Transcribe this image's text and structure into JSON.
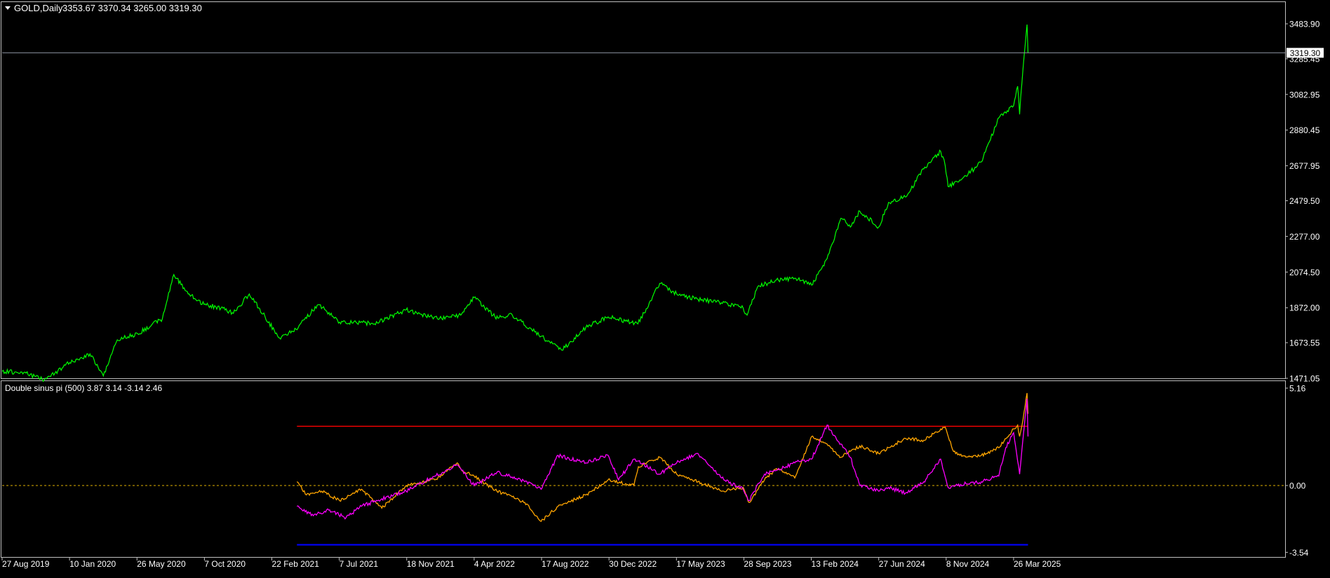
{
  "colors": {
    "background": "#000000",
    "frame": "#c0c0c0",
    "text": "#ffffff",
    "price": "#00ff00",
    "bid_line": "#8a93a0",
    "series1": "#ffa500",
    "series2": "#ff00ff",
    "upper_level": "#ff0000",
    "lower_level": "#0000ff",
    "zero_level": "#e0b000"
  },
  "main_panel": {
    "title": "GOLD,Daily",
    "ohlc": "3353.67 3370.34 3265.00 3319.30",
    "current_price_label": "3319.30"
  },
  "indicator_panel": {
    "title": "Double sinus pi (500) 3.87 3.14 -3.14 2.46"
  },
  "chart_data": [
    {
      "type": "line",
      "title": "GOLD,Daily",
      "ylim": [
        1400,
        3550
      ],
      "y_ticks": [
        "3483.90",
        "3285.45",
        "3082.95",
        "2880.45",
        "2677.95",
        "2479.50",
        "2277.00",
        "2074.50",
        "1872.00",
        "1673.55",
        "1471.05"
      ],
      "x_ticks": [
        "27 Aug 2019",
        "10 Jan 2020",
        "26 May 2020",
        "7 Oct 2020",
        "22 Feb 2021",
        "7 Jul 2021",
        "18 Nov 2021",
        "4 Apr 2022",
        "17 Aug 2022",
        "30 Dec 2022",
        "17 May 2023",
        "28 Sep 2023",
        "13 Feb 2024",
        "27 Jun 2024",
        "8 Nov 2024",
        "26 Mar 2025"
      ],
      "current_value": 3319.3,
      "series": [
        {
          "x": [
            "2019-08-27",
            "2019-10-10",
            "2019-11-20",
            "2020-01-10",
            "2020-02-20",
            "2020-03-18",
            "2020-04-15",
            "2020-05-26",
            "2020-07-15",
            "2020-08-07",
            "2020-09-05",
            "2020-10-07",
            "2020-11-10",
            "2020-12-05",
            "2021-01-06",
            "2021-03-08",
            "2021-04-10",
            "2021-05-25",
            "2021-07-07",
            "2021-08-09",
            "2021-09-15",
            "2021-11-18",
            "2022-01-20",
            "2022-03-08",
            "2022-04-04",
            "2022-05-16",
            "2022-06-20",
            "2022-08-17",
            "2022-09-28",
            "2022-11-15",
            "2022-12-30",
            "2023-02-28",
            "2023-04-13",
            "2023-05-17",
            "2023-06-29",
            "2023-08-15",
            "2023-09-28",
            "2023-10-06",
            "2023-10-27",
            "2023-12-04",
            "2024-01-10",
            "2024-02-13",
            "2024-03-15",
            "2024-04-12",
            "2024-05-01",
            "2024-05-20",
            "2024-06-27",
            "2024-07-17",
            "2024-08-20",
            "2024-09-26",
            "2024-10-30",
            "2024-11-08",
            "2024-11-14",
            "2024-12-20",
            "2025-01-20",
            "2025-02-24",
            "2025-03-26",
            "2025-04-03",
            "2025-04-07",
            "2025-04-14",
            "2025-04-22",
            "2025-04-24"
          ],
          "y": [
            1510,
            1505,
            1462,
            1560,
            1610,
            1485,
            1690,
            1725,
            1810,
            2060,
            1950,
            1890,
            1870,
            1840,
            1950,
            1700,
            1750,
            1890,
            1790,
            1790,
            1780,
            1860,
            1810,
            1830,
            1930,
            1820,
            1830,
            1710,
            1630,
            1760,
            1820,
            1780,
            2010,
            1950,
            1920,
            1900,
            1870,
            1830,
            1990,
            2030,
            2040,
            2000,
            2150,
            2380,
            2330,
            2420,
            2330,
            2470,
            2500,
            2660,
            2760,
            2680,
            2560,
            2620,
            2700,
            2950,
            3020,
            3130,
            2970,
            3230,
            3480,
            3319.3
          ]
        }
      ]
    },
    {
      "type": "line",
      "title": "Double sinus pi (500) 3.87 3.14 -3.14 2.46",
      "ylim": [
        -3.54,
        5.16
      ],
      "y_ticks": [
        "5.16",
        "0.00",
        "-3.54"
      ],
      "levels": [
        3.14,
        0.0,
        -3.14
      ],
      "series": [
        {
          "color": "#ffa500",
          "x": [
            "2021-04-12",
            "2021-05-01",
            "2021-06-01",
            "2021-07-07",
            "2021-08-20",
            "2021-09-30",
            "2021-11-18",
            "2022-01-15",
            "2022-03-01",
            "2022-03-10",
            "2022-04-04",
            "2022-05-20",
            "2022-06-20",
            "2022-07-15",
            "2022-08-17",
            "2022-09-20",
            "2022-11-15",
            "2022-12-30",
            "2023-02-20",
            "2023-03-01",
            "2023-04-13",
            "2023-05-17",
            "2023-06-29",
            "2023-08-20",
            "2023-09-28",
            "2023-10-10",
            "2023-11-10",
            "2023-12-04",
            "2024-01-10",
            "2024-02-13",
            "2024-03-15",
            "2024-04-12",
            "2024-05-20",
            "2024-06-27",
            "2024-07-17",
            "2024-08-20",
            "2024-09-26",
            "2024-10-30",
            "2024-11-08",
            "2024-11-25",
            "2024-12-20",
            "2025-01-20",
            "2025-02-24",
            "2025-03-26",
            "2025-04-03",
            "2025-04-07",
            "2025-04-14",
            "2025-04-22",
            "2025-04-24"
          ],
          "y": [
            0.2,
            -0.5,
            -0.3,
            -0.8,
            -0.2,
            -1.2,
            0.0,
            0.3,
            1.2,
            0.8,
            0.5,
            -0.3,
            -0.6,
            -0.9,
            -1.9,
            -1.1,
            -0.5,
            0.3,
            0.0,
            1.0,
            1.5,
            0.6,
            0.2,
            -0.3,
            -0.1,
            -0.9,
            0.3,
            0.9,
            0.4,
            2.6,
            2.2,
            1.5,
            2.1,
            1.7,
            2.0,
            2.5,
            2.4,
            3.0,
            3.1,
            1.8,
            1.5,
            1.6,
            2.0,
            3.0,
            3.2,
            2.6,
            3.5,
            4.9,
            3.8
          ]
        },
        {
          "color": "#ff00ff",
          "x": [
            "2021-04-12",
            "2021-05-15",
            "2021-06-15",
            "2021-07-20",
            "2021-08-20",
            "2021-09-30",
            "2021-11-18",
            "2022-01-15",
            "2022-03-01",
            "2022-03-10",
            "2022-04-04",
            "2022-05-20",
            "2022-06-15",
            "2022-07-15",
            "2022-08-17",
            "2022-09-20",
            "2022-11-15",
            "2022-12-30",
            "2023-01-20",
            "2023-02-20",
            "2023-03-01",
            "2023-04-13",
            "2023-05-17",
            "2023-06-29",
            "2023-08-20",
            "2023-09-28",
            "2023-10-10",
            "2023-11-10",
            "2023-12-04",
            "2024-01-10",
            "2024-02-13",
            "2024-03-15",
            "2024-04-12",
            "2024-05-01",
            "2024-05-20",
            "2024-06-27",
            "2024-07-17",
            "2024-08-20",
            "2024-09-26",
            "2024-10-30",
            "2024-11-14",
            "2024-12-20",
            "2025-01-20",
            "2025-02-24",
            "2025-03-10",
            "2025-03-26",
            "2025-04-03",
            "2025-04-07",
            "2025-04-14",
            "2025-04-22",
            "2025-04-24"
          ],
          "y": [
            -1.1,
            -1.6,
            -1.3,
            -1.7,
            -1.1,
            -0.7,
            -0.3,
            0.5,
            1.1,
            0.8,
            0.0,
            0.7,
            0.5,
            0.2,
            -0.2,
            1.6,
            1.2,
            1.6,
            0.3,
            1.4,
            1.3,
            0.6,
            1.2,
            1.7,
            0.3,
            -0.2,
            -0.8,
            0.6,
            0.8,
            1.2,
            1.4,
            3.2,
            2.2,
            1.5,
            0.0,
            -0.3,
            -0.1,
            -0.4,
            0.2,
            1.4,
            -0.1,
            0.1,
            0.2,
            0.5,
            2.0,
            2.8,
            1.3,
            0.6,
            2.5,
            4.6,
            2.6
          ]
        }
      ]
    }
  ]
}
